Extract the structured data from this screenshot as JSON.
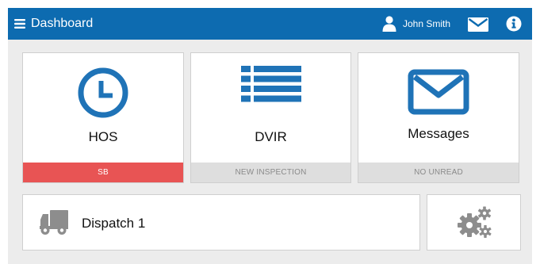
{
  "header": {
    "title": "Dashboard",
    "user_name": "John Smith",
    "icons": [
      "hamburger-menu-icon",
      "user-icon",
      "envelope-icon",
      "info-icon"
    ]
  },
  "tiles": {
    "hos": {
      "label": "HOS",
      "status": "SB",
      "icon": "clock-icon"
    },
    "dvir": {
      "label": "DVIR",
      "status": "NEW INSPECTION",
      "icon": "list-icon"
    },
    "messages": {
      "label": "Messages",
      "status": "NO UNREAD",
      "icon": "envelope-icon"
    }
  },
  "dispatch": {
    "label": "Dispatch 1",
    "icon": "truck-icon"
  },
  "settings": {
    "icon": "gears-icon"
  },
  "colors": {
    "header": "#0d6bb0",
    "brand_blue": "#1f73b7",
    "alert_red": "#e85454",
    "background": "#ececec",
    "icon_gray": "#8d8d8d"
  }
}
